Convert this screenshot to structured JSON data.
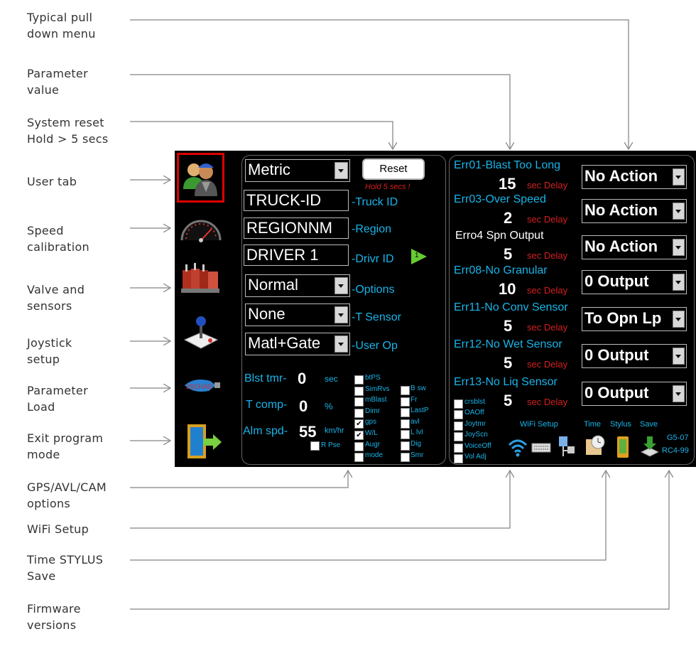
{
  "annotations": [
    "Typical pull\ndown menu",
    "Parameter\nvalue",
    "System reset\nHold > 5 secs",
    "User tab",
    "Speed\ncalibration",
    "Valve and\nsensors",
    "Joystick\nsetup",
    "Parameter\nLoad",
    "Exit program\nmode",
    "GPS/AVL/CAM\noptions",
    "WiFi Setup",
    "Time STYLUS\nSave",
    "Firmware\nversions"
  ],
  "sidebar": {
    "tabs": [
      "user-tab-icon",
      "speedometer-icon",
      "valve-icon",
      "joystick-icon",
      "usb-load-icon",
      "exit-door-icon"
    ],
    "load_label": "2SCHAD"
  },
  "left": {
    "units": "Metric",
    "reset_label": "Reset",
    "reset_hint": "Hold 5 secs !",
    "truck_id": "TRUCK-ID",
    "truck_id_label": "-Truck ID",
    "region": "REGIONNM",
    "region_label": "-Region",
    "driver": "DRIVER 1",
    "driver_label": "-Drivr ID",
    "driver_num": "1",
    "options": "Normal",
    "options_label": "-Options",
    "tsensor": "None",
    "tsensor_label": "-T Sensor",
    "userop": "Matl+Gate",
    "userop_label": "-User Op",
    "blst_label": "Blst tmr-",
    "blst_value": "0",
    "blst_unit": "sec",
    "tcomp_label": "T comp-",
    "tcomp_value": "0",
    "tcomp_unit": "%",
    "alm_label": "Alm spd-",
    "alm_value": "55",
    "alm_unit": "km/hr",
    "rpse_label": "R Pse",
    "rpse_checked": false
  },
  "checks_col1": [
    {
      "label": "btPS",
      "checked": false
    },
    {
      "label": "SimRvs",
      "checked": false
    },
    {
      "label": "mBlast",
      "checked": false
    },
    {
      "label": "Dimr",
      "checked": false
    },
    {
      "label": "gps",
      "checked": true
    },
    {
      "label": "W/L",
      "checked": true
    },
    {
      "label": "Augr",
      "checked": false
    },
    {
      "label": "mode",
      "checked": false
    }
  ],
  "checks_col2": [
    {
      "label": "B sw",
      "checked": false
    },
    {
      "label": "Fr",
      "checked": false
    },
    {
      "label": "LastP",
      "checked": false
    },
    {
      "label": "avl",
      "checked": false
    },
    {
      "label": "L lvl",
      "checked": false
    },
    {
      "label": "Dig",
      "checked": false
    },
    {
      "label": "Smr",
      "checked": false
    }
  ],
  "errors": [
    {
      "title": "Err01-Blast Too Long",
      "value": "15",
      "delay": "sec Delay",
      "action": "No Action"
    },
    {
      "title": "Err03-Over Speed",
      "value": "2",
      "delay": "sec Delay",
      "action": "No Action"
    },
    {
      "title": "Erro4 Spn Output",
      "value": "5",
      "delay": "sec Delay",
      "action": "No Action"
    },
    {
      "title": "Err08-No Granular",
      "value": "10",
      "delay": "sec Delay",
      "action": "0 Output"
    },
    {
      "title": "Err11-No Conv Sensor",
      "value": "5",
      "delay": "sec Delay",
      "action": "To Opn Lp"
    },
    {
      "title": "Err12-No Wet Sensor",
      "value": "5",
      "delay": "sec Delay",
      "action": "0 Output"
    },
    {
      "title": "Err13-No Liq Sensor",
      "value": "5",
      "delay": "sec Delay",
      "action": "0 Output"
    }
  ],
  "checks_right": [
    {
      "label": "crsblst",
      "checked": false
    },
    {
      "label": "OAOff",
      "checked": false
    },
    {
      "label": "Joytmr",
      "checked": false
    },
    {
      "label": "JoyScn",
      "checked": false
    },
    {
      "label": "VoiceOff",
      "checked": false
    },
    {
      "label": "Vol Adj",
      "checked": false
    }
  ],
  "bottom": {
    "wifi_label": "WiFi Setup",
    "time_label": "Time",
    "stylus_label": "Stylus",
    "save_label": "Save",
    "fw1": "G5-07",
    "fw2": "RC4-99"
  },
  "colors": {
    "accent": "#19b4e8",
    "delay": "#d42020",
    "selected_border": "#e00000"
  }
}
